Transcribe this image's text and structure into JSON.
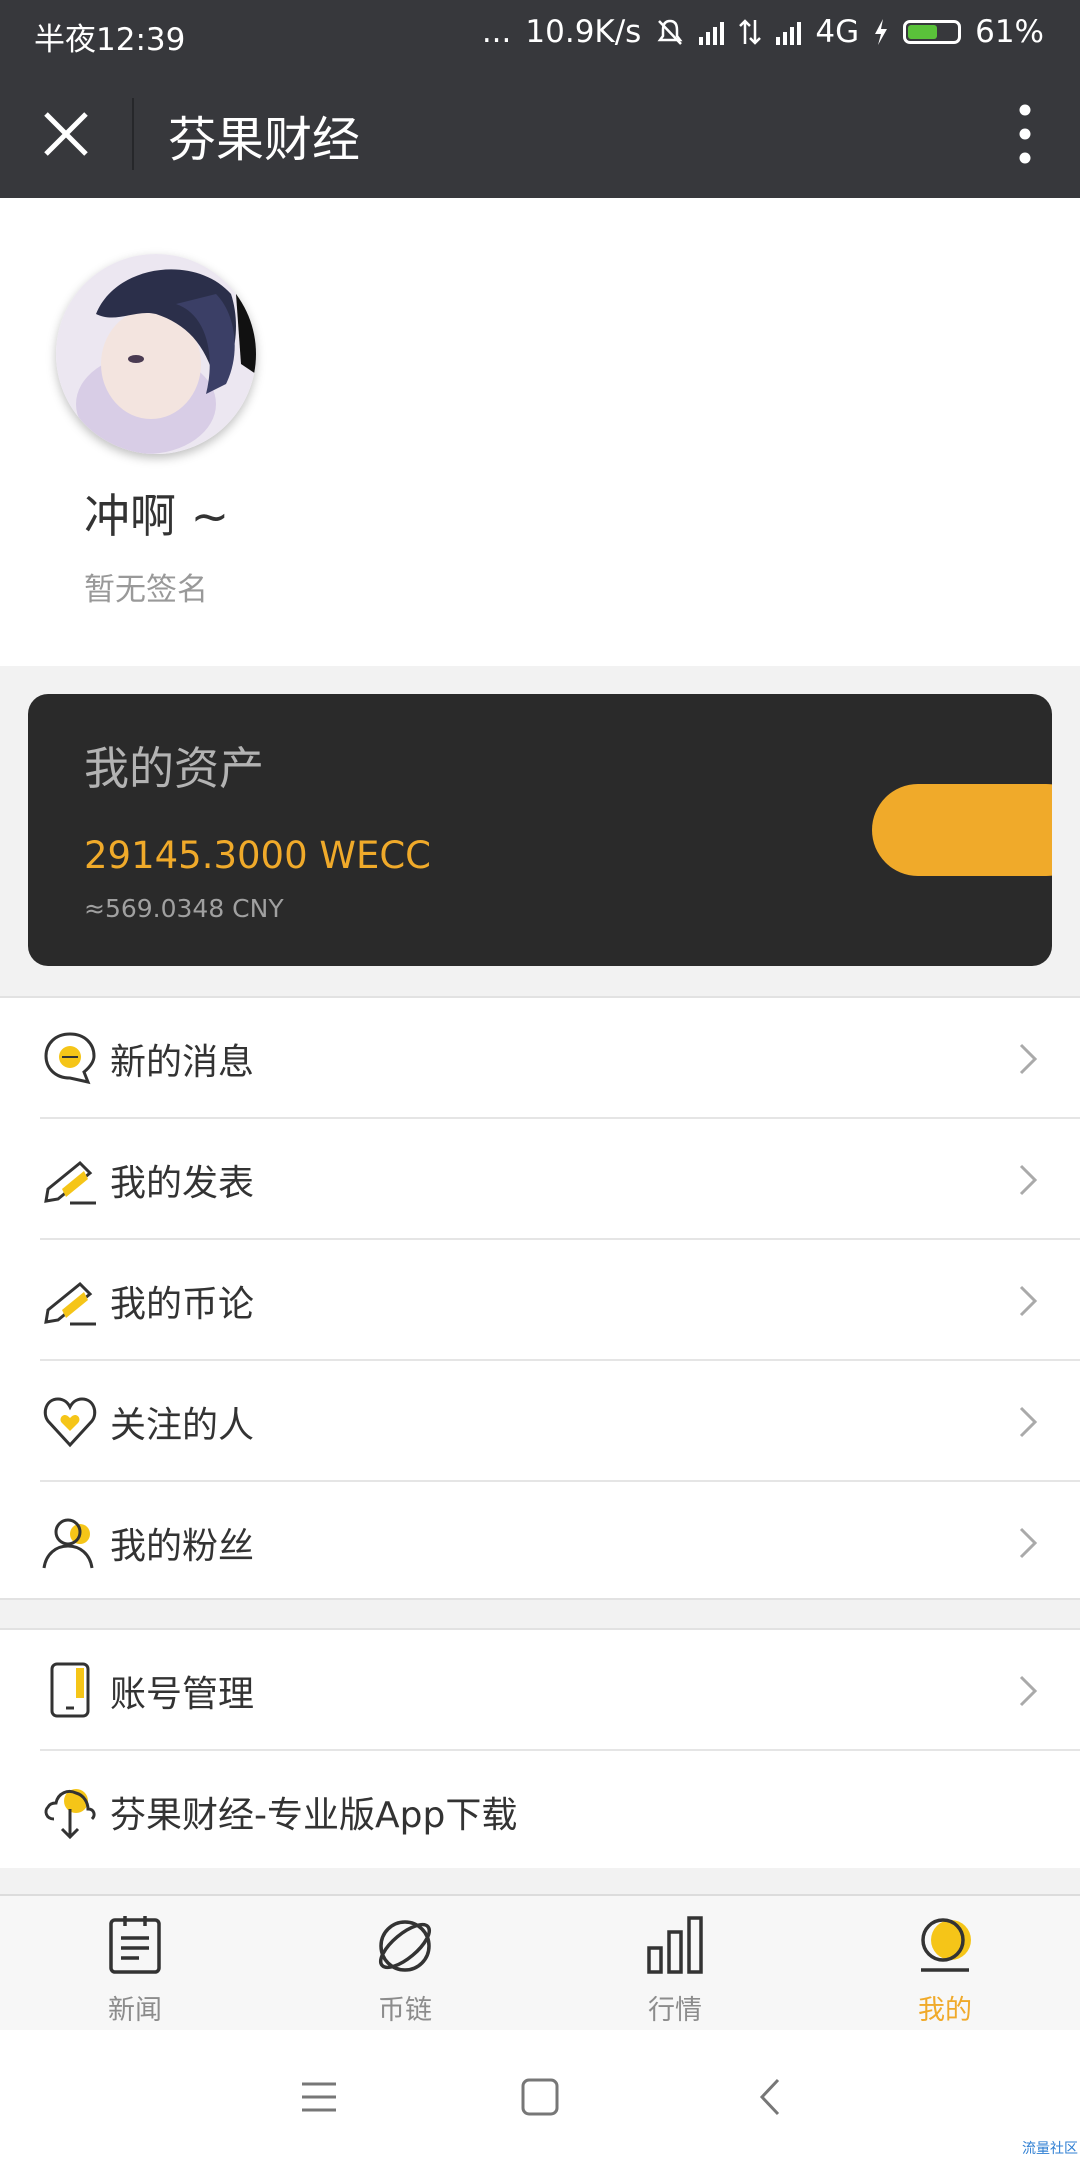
{
  "status_bar": {
    "time": "半夜12:39",
    "dots": "...",
    "speed": "10.9K/s",
    "network": "4G",
    "battery": "61%",
    "battery_level": 0.61
  },
  "header": {
    "title": "芬果财经",
    "close_icon": "close-icon",
    "more_icon": "more-vertical-icon"
  },
  "profile": {
    "username": "冲啊 ~",
    "signature": "暂无签名"
  },
  "assets": {
    "label": "我的资产",
    "amount": "29145.3000 WECC",
    "cny": "≈569.0348 CNY",
    "accent": "#f0aa2a"
  },
  "menu": [
    {
      "label": "新的消息",
      "icon": "message-icon"
    },
    {
      "label": "我的发表",
      "icon": "edit-icon"
    },
    {
      "label": "我的币论",
      "icon": "edit-icon"
    },
    {
      "label": "关注的人",
      "icon": "heart-icon"
    },
    {
      "label": "我的粉丝",
      "icon": "user-icon"
    }
  ],
  "menu2": [
    {
      "label": "账号管理",
      "icon": "phone-icon"
    },
    {
      "label": "芬果财经-专业版App下载",
      "icon": "cloud-download-icon"
    }
  ],
  "tabs": [
    {
      "label": "新闻",
      "icon": "news-icon"
    },
    {
      "label": "币链",
      "icon": "planet-icon"
    },
    {
      "label": "行情",
      "icon": "bar-chart-icon"
    },
    {
      "label": "我的",
      "icon": "profile-icon",
      "active": true
    }
  ],
  "watermark": "流量社区"
}
